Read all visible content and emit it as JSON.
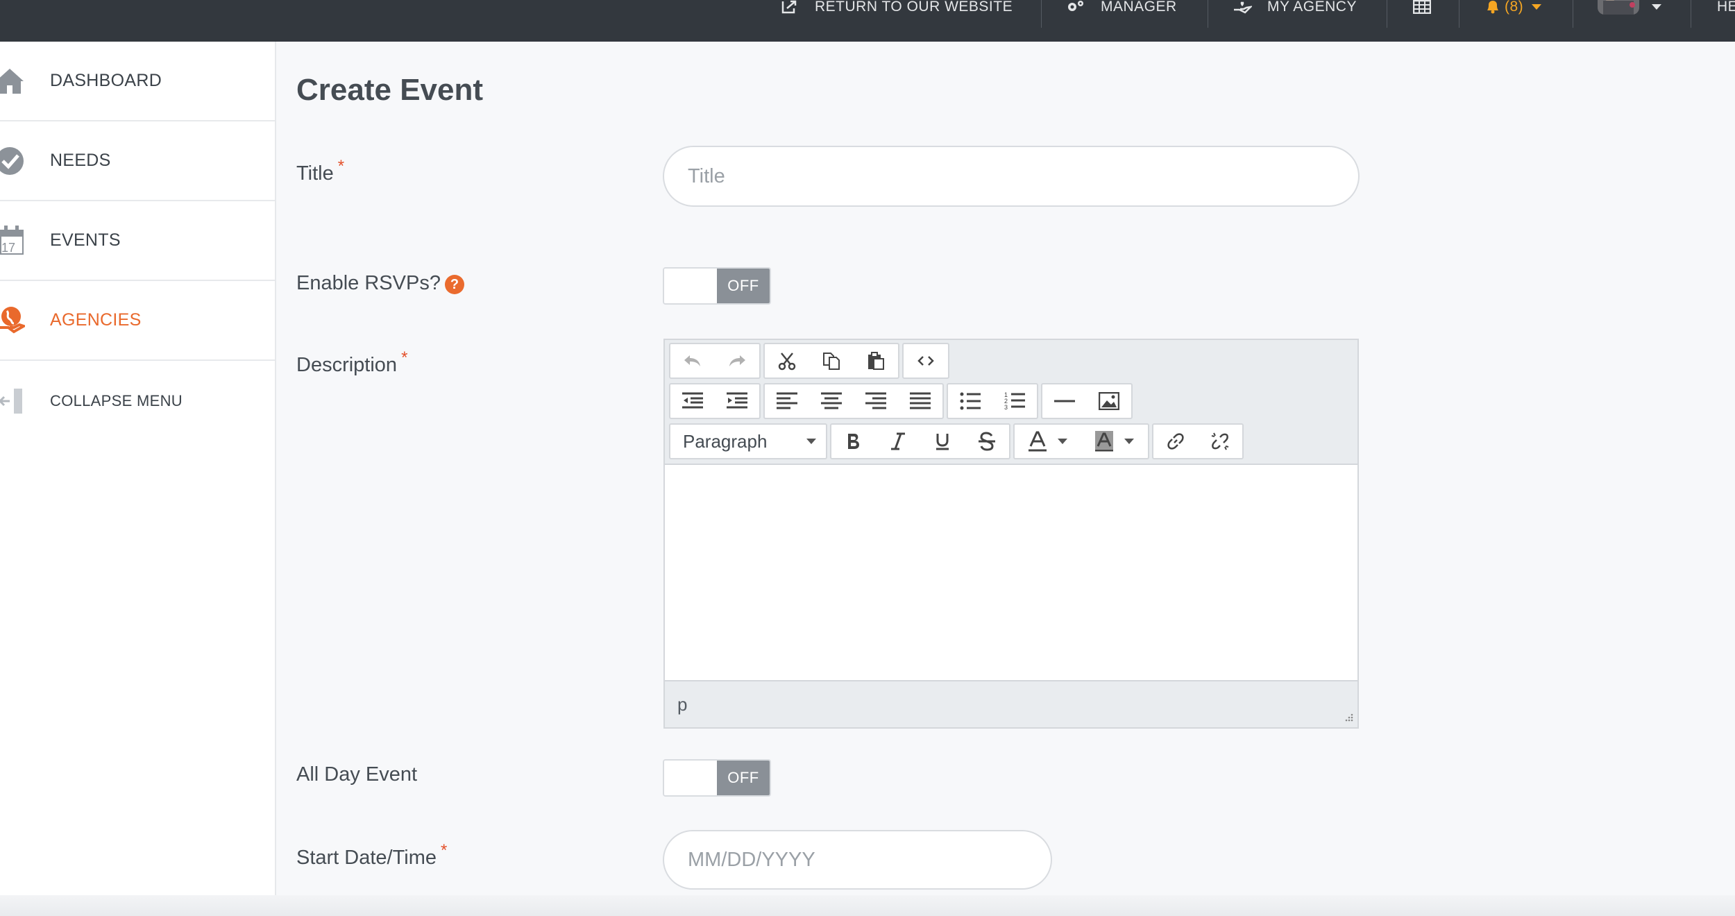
{
  "topnav": {
    "return_label": "RETURN TO OUR WEBSITE",
    "manager_label": "MANAGER",
    "agency_label": "MY AGENCY",
    "notif_label": "(8)",
    "help_partial": "HE"
  },
  "sidebar": {
    "items": [
      {
        "label": "DASHBOARD"
      },
      {
        "label": "NEEDS"
      },
      {
        "label": "EVENTS",
        "icon_text": "17"
      },
      {
        "label": "AGENCIES"
      },
      {
        "label": "COLLAPSE MENU"
      }
    ],
    "active_index": 3
  },
  "page": {
    "title": "Create Event"
  },
  "form": {
    "required_mark": "*",
    "title_label": "Title",
    "title_placeholder": "Title",
    "rsvp_label": "Enable RSVPs?",
    "rsvp_help": "?",
    "rsvp_state": "OFF",
    "description_label": "Description",
    "editor_format": "Paragraph",
    "editor_path": "p",
    "allday_label": "All Day Event",
    "allday_state": "OFF",
    "start_label": "Start Date/Time",
    "start_placeholder": "MM/DD/YYYY"
  },
  "colors": {
    "accent": "#e9692c",
    "topbar": "#33383e",
    "toggle_off": "#8a9097",
    "notification": "#f5a623"
  }
}
